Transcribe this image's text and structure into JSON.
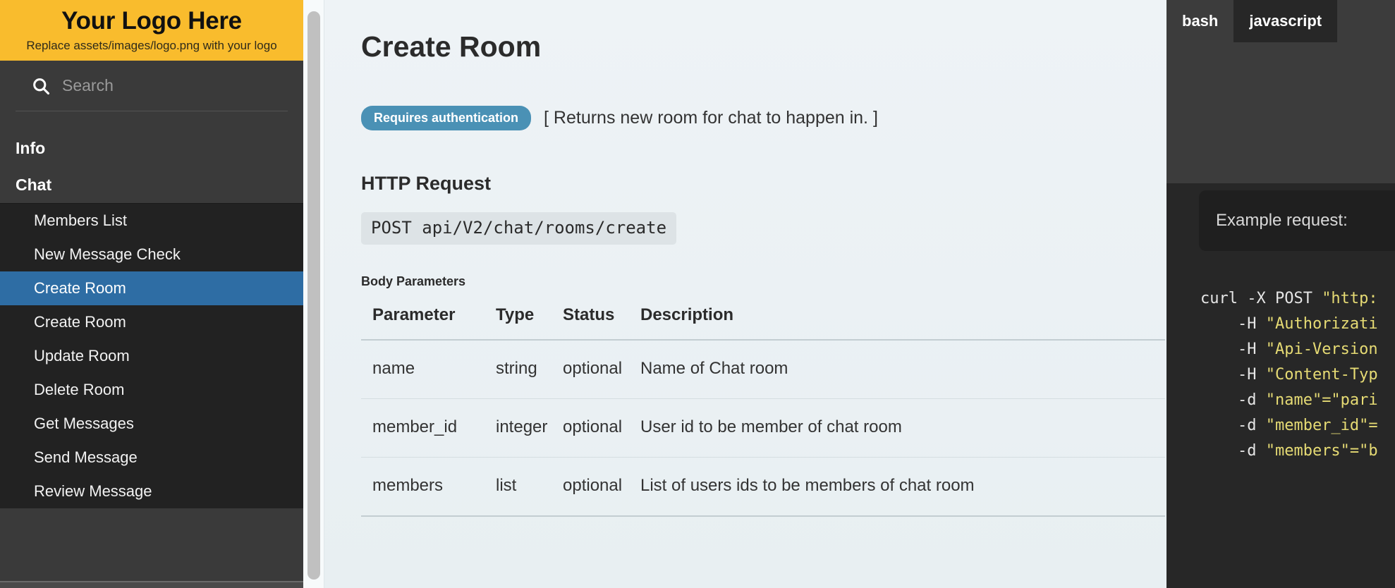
{
  "sidebar": {
    "logo": {
      "title": "Your Logo Here",
      "subtitle": "Replace assets/images/logo.png with your logo"
    },
    "search": {
      "placeholder": "Search",
      "value": "",
      "icon": "search-icon"
    },
    "groups": [
      {
        "label": "Info"
      },
      {
        "label": "Chat"
      }
    ],
    "items": [
      {
        "label": "Members List",
        "active": false
      },
      {
        "label": "New Message Check",
        "active": false
      },
      {
        "label": "Create Room",
        "active": true
      },
      {
        "label": "Create Room",
        "active": false
      },
      {
        "label": "Update Room",
        "active": false
      },
      {
        "label": "Delete Room",
        "active": false
      },
      {
        "label": "Get Messages",
        "active": false
      },
      {
        "label": "Send Message",
        "active": false
      },
      {
        "label": "Review Message",
        "active": false
      }
    ]
  },
  "main": {
    "page_title": "Create Room",
    "auth_badge": "Requires authentication",
    "auth_description": "[ Returns new room for chat to happen in. ]",
    "http_request_heading": "HTTP Request",
    "endpoint": "POST api/V2/chat/rooms/create",
    "table_label": "Body Parameters",
    "table": {
      "headers": [
        "Parameter",
        "Type",
        "Status",
        "Description"
      ],
      "rows": [
        [
          "name",
          "string",
          "optional",
          "Name of Chat room"
        ],
        [
          "member_id",
          "integer",
          "optional",
          "User id to be member of chat room"
        ],
        [
          "members",
          "list",
          "optional",
          "List of users ids to be members of chat room"
        ]
      ]
    }
  },
  "code_panel": {
    "tabs": [
      {
        "label": "bash",
        "active": true
      },
      {
        "label": "javascript",
        "active": false
      }
    ],
    "example_label": "Example request:",
    "code_lines": [
      {
        "plain": "curl -X POST ",
        "string": "\"http:"
      },
      {
        "plain": "    -H ",
        "string": "\"Authorizati"
      },
      {
        "plain": "    -H ",
        "string": "\"Api-Version"
      },
      {
        "plain": "    -H ",
        "string": "\"Content-Typ"
      },
      {
        "plain": "    -d ",
        "string": "\"name\"=\"pari"
      },
      {
        "plain": "    -d ",
        "string": "\"member_id\"="
      },
      {
        "plain": "    -d ",
        "string": "\"members\"=\"b"
      }
    ]
  },
  "colors": {
    "logo_banner": "#f9bc2d",
    "sidebar_bg": "#3a3a3a",
    "sidebar_sub_bg": "#222222",
    "active_item": "#2e6da4",
    "badge": "#4a91b5",
    "main_bg": "#e9f0f3",
    "code_bg": "#272727",
    "tabbar_bg": "#3c3c3c",
    "code_string": "#e6db74"
  }
}
